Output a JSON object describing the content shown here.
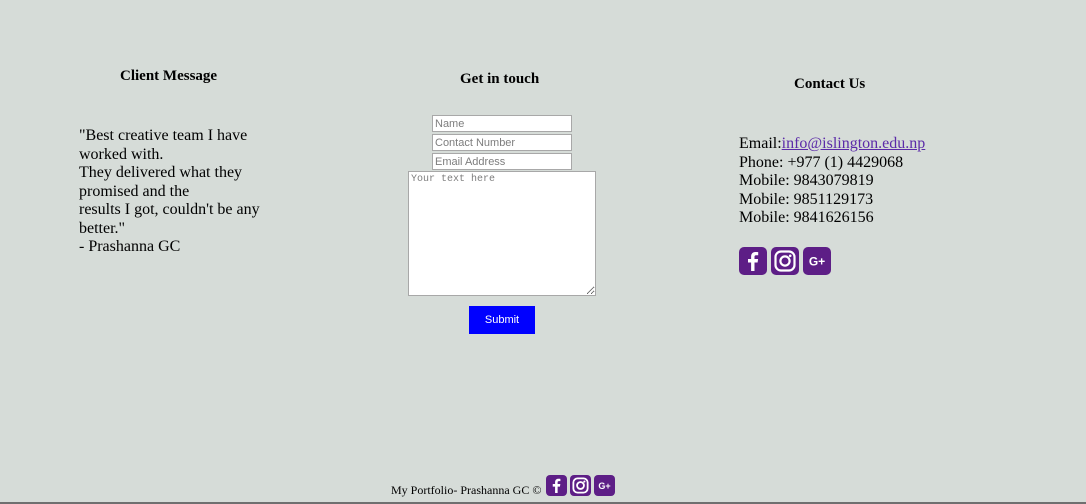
{
  "client": {
    "title": "Client Message",
    "quote_lines": [
      "\"Best creative team I have worked with.",
      "They delivered what they promised and the",
      "results I got, couldn't be any better.\"",
      "- Prashanna GC"
    ]
  },
  "touch": {
    "title": "Get in touch",
    "name_placeholder": "Name",
    "contact_placeholder": "Contact Number",
    "email_placeholder": "Email Address",
    "message_placeholder": "Your text here",
    "submit_label": "Submit"
  },
  "contact": {
    "title": "Contact Us",
    "email_prefix": "Email:",
    "email": "info@islington.edu.np",
    "phone": "Phone: +977 (1) 4429068",
    "mobiles": [
      "Mobile: 9843079819",
      "Mobile: 9851129173",
      "Mobile: 9841626156"
    ]
  },
  "social": {
    "icons": [
      "facebook-icon",
      "instagram-icon",
      "google-plus-icon"
    ],
    "color": "#5d1e86",
    "gplus_text": "G+"
  },
  "footer": {
    "text": "My Portfolio- Prashanna GC ©"
  },
  "colors": {
    "background": "#d6dcd8",
    "submit": "#0000ff",
    "link": "#5b2aa8"
  }
}
